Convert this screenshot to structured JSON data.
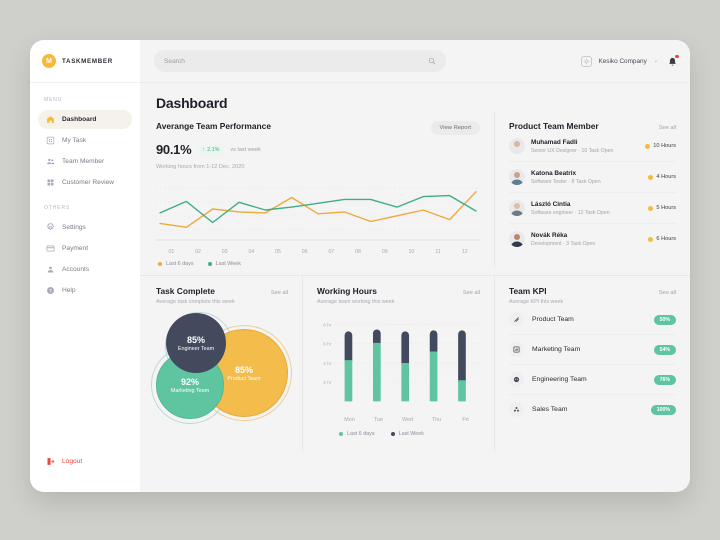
{
  "brand": {
    "mark": "M",
    "name": "TASKMEMBER",
    "accent": "#f6b93b"
  },
  "sidebar": {
    "section_menu": "MENU",
    "section_others": "OTHERS",
    "menu_items": [
      {
        "label": "Dashboard",
        "icon": "home-icon",
        "active": true
      },
      {
        "label": "My Task",
        "icon": "task-icon",
        "active": false
      },
      {
        "label": "Team Member",
        "icon": "team-icon",
        "active": false
      },
      {
        "label": "Customer Review",
        "icon": "review-icon",
        "active": false
      }
    ],
    "other_items": [
      {
        "label": "Settings",
        "icon": "gear-icon"
      },
      {
        "label": "Payment",
        "icon": "card-icon"
      },
      {
        "label": "Accounts",
        "icon": "user-icon"
      },
      {
        "label": "Help",
        "icon": "help-icon"
      }
    ],
    "logout": {
      "label": "Logout",
      "icon": "logout-icon",
      "color": "#f0453a"
    }
  },
  "topbar": {
    "search": {
      "placeholder": "Search",
      "value": "",
      "icon": "search-icon"
    },
    "company": {
      "name": "Kesiko Company",
      "icon": "company-icon",
      "chevron": "⌄"
    },
    "notifications": {
      "icon": "bell-icon",
      "has_unread": true
    }
  },
  "page": {
    "title": "Dashboard"
  },
  "performance": {
    "title": "Averange Team Performance",
    "view_report": "View Report",
    "value": "90.1%",
    "delta": "2.1%",
    "delta_arrow": "↑",
    "delta_caption": "vs last week",
    "subtitle": "Working hours from 1-12 Dec, 2020"
  },
  "product_team": {
    "title": "Product Team Member",
    "see_all": "See all",
    "members": [
      {
        "name": "Muhamad Fadli",
        "meta": "Senior UX Designer  ·  10 Task Open",
        "hours": "10 Hours"
      },
      {
        "name": "Katona Beatrix",
        "meta": "Software Tester  ·  8 Task Open",
        "hours": "4 Hours"
      },
      {
        "name": "László Cintia",
        "meta": "Software engineer  ·  12 Task Open",
        "hours": "5 Hours"
      },
      {
        "name": "Novák Réka",
        "meta": "Development  ·  3 Task Open",
        "hours": "6 Hours"
      }
    ]
  },
  "task_complete": {
    "title": "Task Complete",
    "see_all": "See all",
    "subtitle": "Average task complete this week",
    "bubbles": [
      {
        "pct": "85%",
        "name": "Engineer Team",
        "color": "#434a5e"
      },
      {
        "pct": "92%",
        "name": "Marketing Team",
        "color": "#5ec5a0"
      },
      {
        "pct": "85%",
        "name": "Product Team",
        "color": "#f3bc4b"
      }
    ]
  },
  "working_hours": {
    "title": "Working Hours",
    "see_all": "See all",
    "subtitle": "Average team working this week"
  },
  "team_kpi": {
    "title": "Team KPI",
    "see_all": "See all",
    "subtitle": "Average KPI this week",
    "rows": [
      {
        "label": "Product Team",
        "value": "50%",
        "icon": "slash-icon"
      },
      {
        "label": "Marketing Team",
        "value": "54%",
        "icon": "chart-icon"
      },
      {
        "label": "Engineering Team",
        "value": "76%",
        "icon": "gear-wheel-icon"
      },
      {
        "label": "Sales Team",
        "value": "100%",
        "icon": "network-icon"
      }
    ]
  },
  "chart_data": [
    {
      "type": "line",
      "title": "Averange Team Performance",
      "xlabel": "",
      "ylabel": "",
      "categories": [
        "01",
        "02",
        "03",
        "04",
        "05",
        "06",
        "07",
        "08",
        "09",
        "10",
        "11",
        "12"
      ],
      "ylim": [
        0,
        100
      ],
      "grid": true,
      "legend_position": "bottom-left",
      "series": [
        {
          "name": "Last 6 days",
          "color": "#f0a93b",
          "values": [
            22,
            14,
            52,
            46,
            44,
            76,
            42,
            46,
            26,
            38,
            50,
            30,
            88
          ]
        },
        {
          "name": "Last Week",
          "color": "#3fae87",
          "values": [
            44,
            68,
            24,
            66,
            50,
            56,
            64,
            72,
            72,
            56,
            78,
            80,
            48
          ]
        }
      ]
    },
    {
      "type": "bar",
      "title": "Working Hours",
      "xlabel": "",
      "ylabel": "hr",
      "categories": [
        "Mon",
        "Tue",
        "Wed",
        "Thu",
        "Fri"
      ],
      "yticks": [
        "2 hr",
        "4 hr",
        "6 hr",
        "8 hr"
      ],
      "ylim": [
        0,
        8
      ],
      "stacked": true,
      "grid": true,
      "legend_position": "bottom",
      "series": [
        {
          "name": "Last 6 days",
          "color": "#5ec5a0",
          "values": [
            4.3,
            6.1,
            4.0,
            5.2,
            2.2
          ]
        },
        {
          "name": "Last Week",
          "color": "#434a5e",
          "values": [
            7.3,
            7.5,
            7.3,
            7.4,
            7.4
          ]
        }
      ]
    },
    {
      "type": "pie",
      "title": "Task Complete",
      "labels": [
        "Engineer Team",
        "Marketing Team",
        "Product Team"
      ],
      "values": [
        85,
        92,
        85
      ],
      "colors": [
        "#434a5e",
        "#5ec5a0",
        "#f3bc4b"
      ]
    }
  ]
}
